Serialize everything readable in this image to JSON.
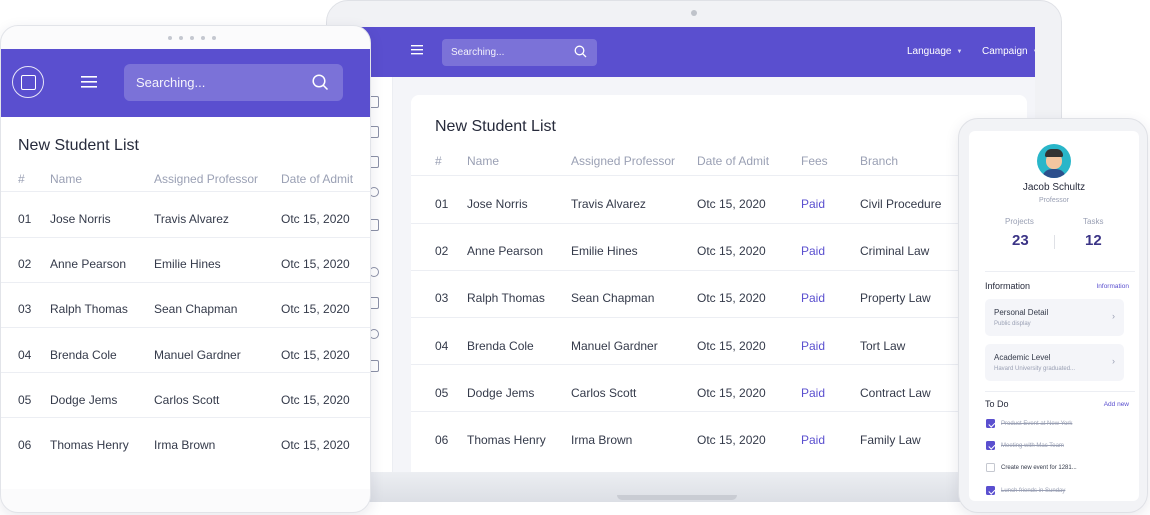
{
  "colors": {
    "accent": "#5a4fcf",
    "accent_dark": "#3b3486",
    "text_muted": "#9aa0b4"
  },
  "search": {
    "placeholder": "Searching..."
  },
  "header_nav": [
    {
      "label": "Language",
      "icon": "chevron-down-icon"
    },
    {
      "label": "Campaign",
      "icon": "chevron-down-icon"
    }
  ],
  "laptop": {
    "title": "New Student List",
    "columns": [
      "#",
      "Name",
      "Assigned Professor",
      "Date of Admit",
      "Fees",
      "Branch"
    ],
    "rows": [
      {
        "num": "01",
        "name": "Jose Norris",
        "professor": "Travis Alvarez",
        "date": "Otc 15, 2020",
        "fees": "Paid",
        "branch": "Civil Procedure"
      },
      {
        "num": "02",
        "name": "Anne Pearson",
        "professor": "Emilie Hines",
        "date": "Otc 15, 2020",
        "fees": "Paid",
        "branch": "Criminal Law"
      },
      {
        "num": "03",
        "name": "Ralph Thomas",
        "professor": "Sean Chapman",
        "date": "Otc 15, 2020",
        "fees": "Paid",
        "branch": "Property Law"
      },
      {
        "num": "04",
        "name": "Brenda Cole",
        "professor": "Manuel Gardner",
        "date": "Otc 15, 2020",
        "fees": "Paid",
        "branch": "Tort Law"
      },
      {
        "num": "05",
        "name": "Dodge Jems",
        "professor": "Carlos Scott",
        "date": "Otc 15, 2020",
        "fees": "Paid",
        "branch": "Contract Law"
      },
      {
        "num": "06",
        "name": "Thomas Henry",
        "professor": "Irma Brown",
        "date": "Otc 15, 2020",
        "fees": "Paid",
        "branch": "Family Law"
      }
    ]
  },
  "tablet": {
    "title": "New Student List",
    "columns": [
      "#",
      "Name",
      "Assigned Professor",
      "Date of Admit"
    ],
    "rows": [
      {
        "num": "01",
        "name": "Jose Norris",
        "professor": "Travis Alvarez",
        "date": "Otc 15, 2020"
      },
      {
        "num": "02",
        "name": "Anne Pearson",
        "professor": "Emilie Hines",
        "date": "Otc 15, 2020"
      },
      {
        "num": "03",
        "name": "Ralph Thomas",
        "professor": "Sean Chapman",
        "date": "Otc 15, 2020"
      },
      {
        "num": "04",
        "name": "Brenda Cole",
        "professor": "Manuel Gardner",
        "date": "Otc 15, 2020"
      },
      {
        "num": "05",
        "name": "Dodge Jems",
        "professor": "Carlos Scott",
        "date": "Otc 15, 2020"
      },
      {
        "num": "06",
        "name": "Thomas Henry",
        "professor": "Irma Brown",
        "date": "Otc 15, 2020"
      }
    ]
  },
  "phone": {
    "profile": {
      "name": "Jacob Schultz",
      "role": "Professor"
    },
    "stats": [
      {
        "label": "Projects",
        "value": "23"
      },
      {
        "label": "Tasks",
        "value": "12"
      }
    ],
    "information": {
      "title": "Information",
      "link": "Information",
      "items": [
        {
          "title": "Personal Detail",
          "subtitle": "Public display"
        },
        {
          "title": "Academic Level",
          "subtitle": "Havard University graduated..."
        }
      ]
    },
    "todo": {
      "title": "To Do",
      "link": "Add new",
      "items": [
        {
          "label": "Product Event at New York",
          "done": true
        },
        {
          "label": "Meeting with Mac Team",
          "done": true
        },
        {
          "label": "Create new event for 1281...",
          "done": false
        },
        {
          "label": "Lunch friends in Sunday",
          "done": true
        }
      ]
    }
  }
}
